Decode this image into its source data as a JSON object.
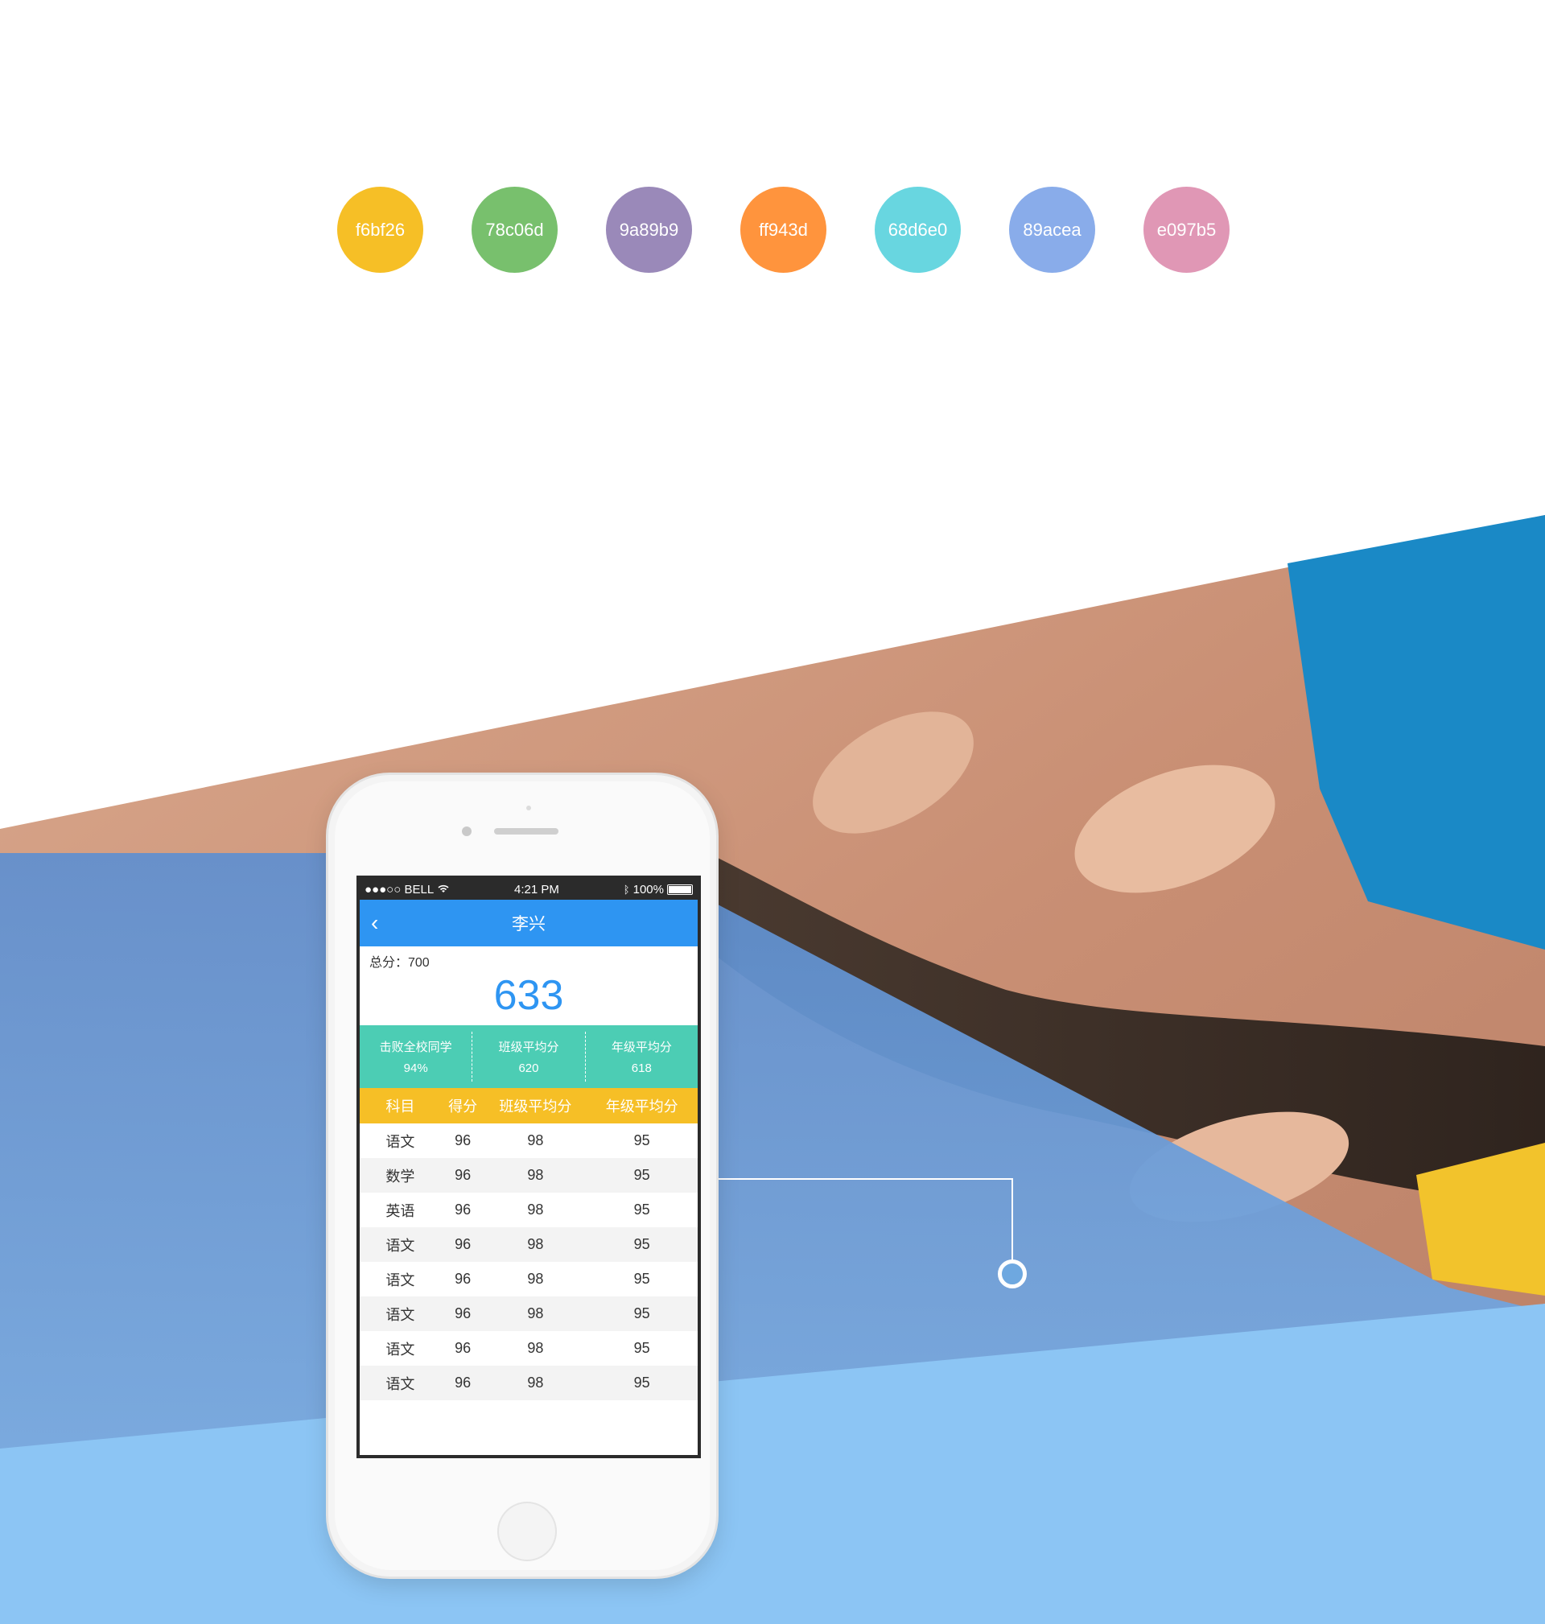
{
  "palette": [
    {
      "label": "f6bf26",
      "color": "#f6bf26"
    },
    {
      "label": "78c06d",
      "color": "#78c06d"
    },
    {
      "label": "9a89b9",
      "color": "#9a89b9"
    },
    {
      "label": "ff943d",
      "color": "#ff943d"
    },
    {
      "label": "68d6e0",
      "color": "#68d6e0"
    },
    {
      "label": "89acea",
      "color": "#89acea"
    },
    {
      "label": "e097b5",
      "color": "#e097b5"
    }
  ],
  "status_bar": {
    "carrier": "●●●○○ BELL",
    "time": "4:21 PM",
    "battery": "100%"
  },
  "nav": {
    "back_icon": "chevron-left-icon",
    "title": "李兴"
  },
  "summary": {
    "total_label": "总分：700",
    "score": "633"
  },
  "stats": [
    {
      "label": "击败全校同学",
      "value": "94%"
    },
    {
      "label": "班级平均分",
      "value": "620"
    },
    {
      "label": "年级平均分",
      "value": "618"
    }
  ],
  "table": {
    "headers": [
      "科目",
      "得分",
      "班级平均分",
      "年级平均分"
    ],
    "rows": [
      [
        "语文",
        "96",
        "98",
        "95"
      ],
      [
        "数学",
        "96",
        "98",
        "95"
      ],
      [
        "英语",
        "96",
        "98",
        "95"
      ],
      [
        "语文",
        "96",
        "98",
        "95"
      ],
      [
        "语文",
        "96",
        "98",
        "95"
      ],
      [
        "语文",
        "96",
        "98",
        "95"
      ],
      [
        "语文",
        "96",
        "98",
        "95"
      ],
      [
        "语文",
        "96",
        "98",
        "95"
      ]
    ]
  },
  "colors": {
    "nav_blue": "#2e95f2",
    "stats_teal": "#4ccdb4",
    "header_yellow": "#f6bf26",
    "hero_blue": "#8cc5f4"
  }
}
